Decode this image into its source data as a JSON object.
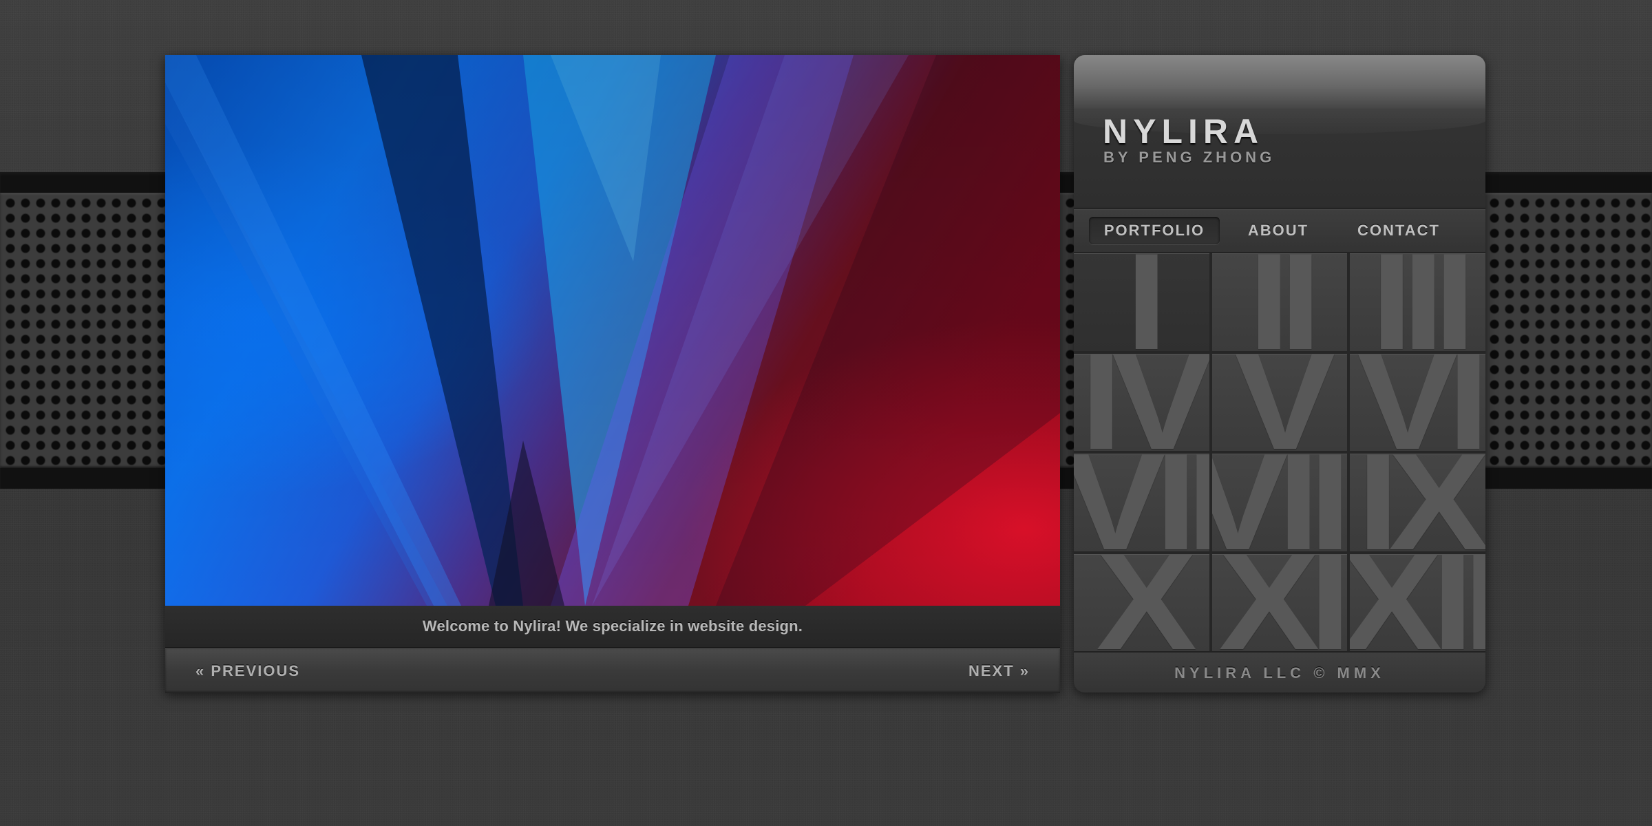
{
  "site": {
    "name": "NYLIRA",
    "byline": "BY PENG ZHONG"
  },
  "navigation": [
    {
      "label": "PORTFOLIO",
      "active": true
    },
    {
      "label": "ABOUT",
      "active": false
    },
    {
      "label": "CONTACT",
      "active": false
    }
  ],
  "slideshow": {
    "caption": "Welcome to Nylira! We specialize in website design.",
    "previous_label": "« PREVIOUS",
    "next_label": "NEXT »"
  },
  "portfolio_tiles": [
    {
      "label": "I",
      "active": true
    },
    {
      "label": "II",
      "active": false
    },
    {
      "label": "III",
      "active": false
    },
    {
      "label": "IV",
      "active": false
    },
    {
      "label": "V",
      "active": false
    },
    {
      "label": "VI",
      "active": false
    },
    {
      "label": "VII",
      "active": false
    },
    {
      "label": "VIII",
      "active": false
    },
    {
      "label": "IX",
      "active": false
    },
    {
      "label": "X",
      "active": false
    },
    {
      "label": "XI",
      "active": false
    },
    {
      "label": "XII",
      "active": false
    }
  ],
  "footer": {
    "text": "NYLIRA LLC © MMX"
  },
  "colors": {
    "background": "#3a3a3a",
    "text_light": "#d8d8d8",
    "text_muted": "#8a8a8a",
    "slide_blue": "#0a6ef0",
    "slide_red": "#c40a22"
  }
}
